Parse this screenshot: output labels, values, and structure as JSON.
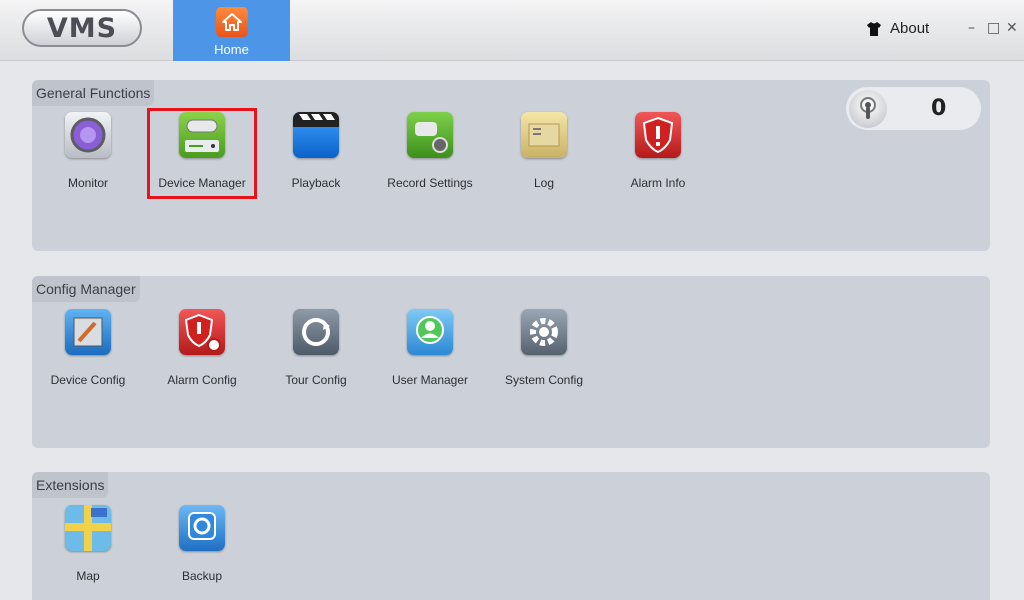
{
  "app": {
    "logo_text": "VMS"
  },
  "tabs": [
    {
      "label": "Home",
      "icon": "home-icon",
      "active": true
    }
  ],
  "header": {
    "about_label": "About",
    "minimize": "–",
    "maximize": "□",
    "close": "✕"
  },
  "counter": {
    "value": "0",
    "icon": "speaker-icon"
  },
  "sections": [
    {
      "title": "General Functions",
      "items": [
        {
          "label": "Monitor",
          "icon": "monitor-icon"
        },
        {
          "label": "Device Manager",
          "icon": "device-manager-icon",
          "highlighted": true
        },
        {
          "label": "Playback",
          "icon": "playback-icon"
        },
        {
          "label": "Record Settings",
          "icon": "record-settings-icon"
        },
        {
          "label": "Log",
          "icon": "log-icon"
        },
        {
          "label": "Alarm Info",
          "icon": "alarm-info-icon"
        }
      ]
    },
    {
      "title": "Config Manager",
      "items": [
        {
          "label": "Device Config",
          "icon": "device-config-icon"
        },
        {
          "label": "Alarm Config",
          "icon": "alarm-config-icon"
        },
        {
          "label": "Tour Config",
          "icon": "tour-config-icon"
        },
        {
          "label": "User Manager",
          "icon": "user-manager-icon"
        },
        {
          "label": "System Config",
          "icon": "system-config-icon"
        }
      ]
    },
    {
      "title": "Extensions",
      "items": [
        {
          "label": "Map",
          "icon": "map-icon"
        },
        {
          "label": "Backup",
          "icon": "backup-icon"
        }
      ]
    }
  ],
  "colors": {
    "accent": "#4d95e6",
    "highlight": "#e5141b",
    "panel": "#ccd1d9"
  }
}
